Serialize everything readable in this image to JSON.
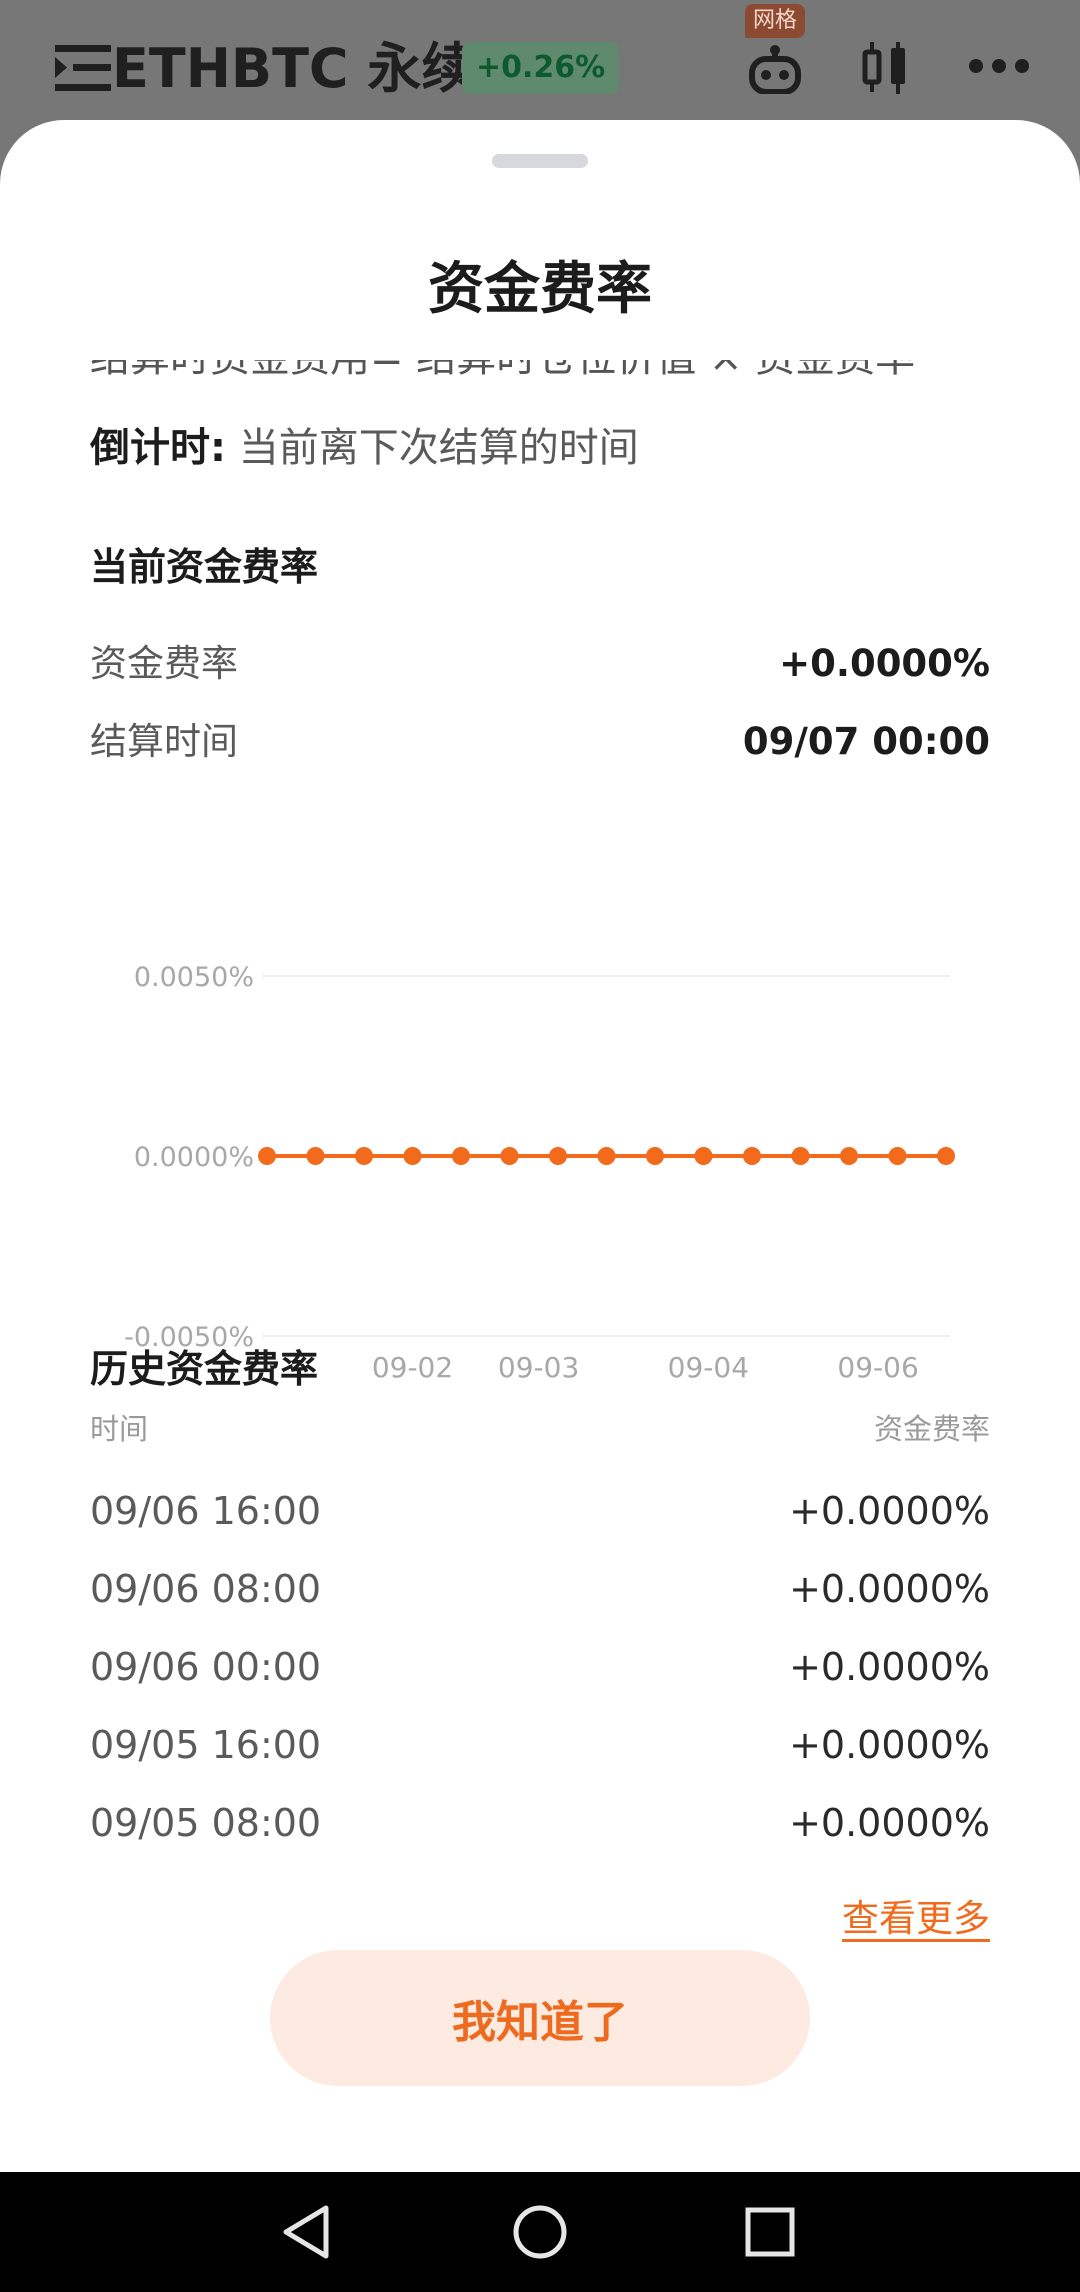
{
  "topbar": {
    "title": "ETHBTC 永续",
    "change": "+0.26%",
    "bot_badge": "网格"
  },
  "sheet": {
    "title": "资金费率",
    "clipped_text": "结算时资金费用= 结算时仓位价值 × 资金费率",
    "countdown_label": "倒计时:",
    "countdown_text": "当前离下次结算的时间",
    "current_section": "当前资金费率",
    "current_rate_label": "资金费率",
    "current_rate_value": "+0.0000%",
    "settle_label": "结算时间",
    "settle_value": "09/07 00:00",
    "history_section": "历史资金费率",
    "history_col_time": "时间",
    "history_col_rate": "资金费率",
    "history_rows": [
      {
        "time": "09/06 16:00",
        "rate": "+0.0000%"
      },
      {
        "time": "09/06 08:00",
        "rate": "+0.0000%"
      },
      {
        "time": "09/06 00:00",
        "rate": "+0.0000%"
      },
      {
        "time": "09/05 16:00",
        "rate": "+0.0000%"
      },
      {
        "time": "09/05 08:00",
        "rate": "+0.0000%"
      }
    ],
    "more_link": "查看更多",
    "ok_button": "我知道了"
  },
  "colors": {
    "accent": "#f26a1b",
    "positive": "#0c5a2e",
    "grid": "#f0f0f0"
  },
  "chart_data": {
    "type": "line",
    "ytick_labels": [
      "0.0050%",
      "0.0000%",
      "-0.0050%"
    ],
    "yticks": [
      0.005,
      0,
      -0.005
    ],
    "ylim": [
      -0.005,
      0.005
    ],
    "xtick_labels": [
      "09-02",
      "09-03",
      "09-04",
      "09-06"
    ],
    "xtick_index": [
      3,
      5.6,
      9.1,
      12.6
    ],
    "series": [
      {
        "values": [
          0,
          0,
          0,
          0,
          0,
          0,
          0,
          0,
          0,
          0,
          0,
          0,
          0,
          0,
          0
        ]
      }
    ]
  }
}
